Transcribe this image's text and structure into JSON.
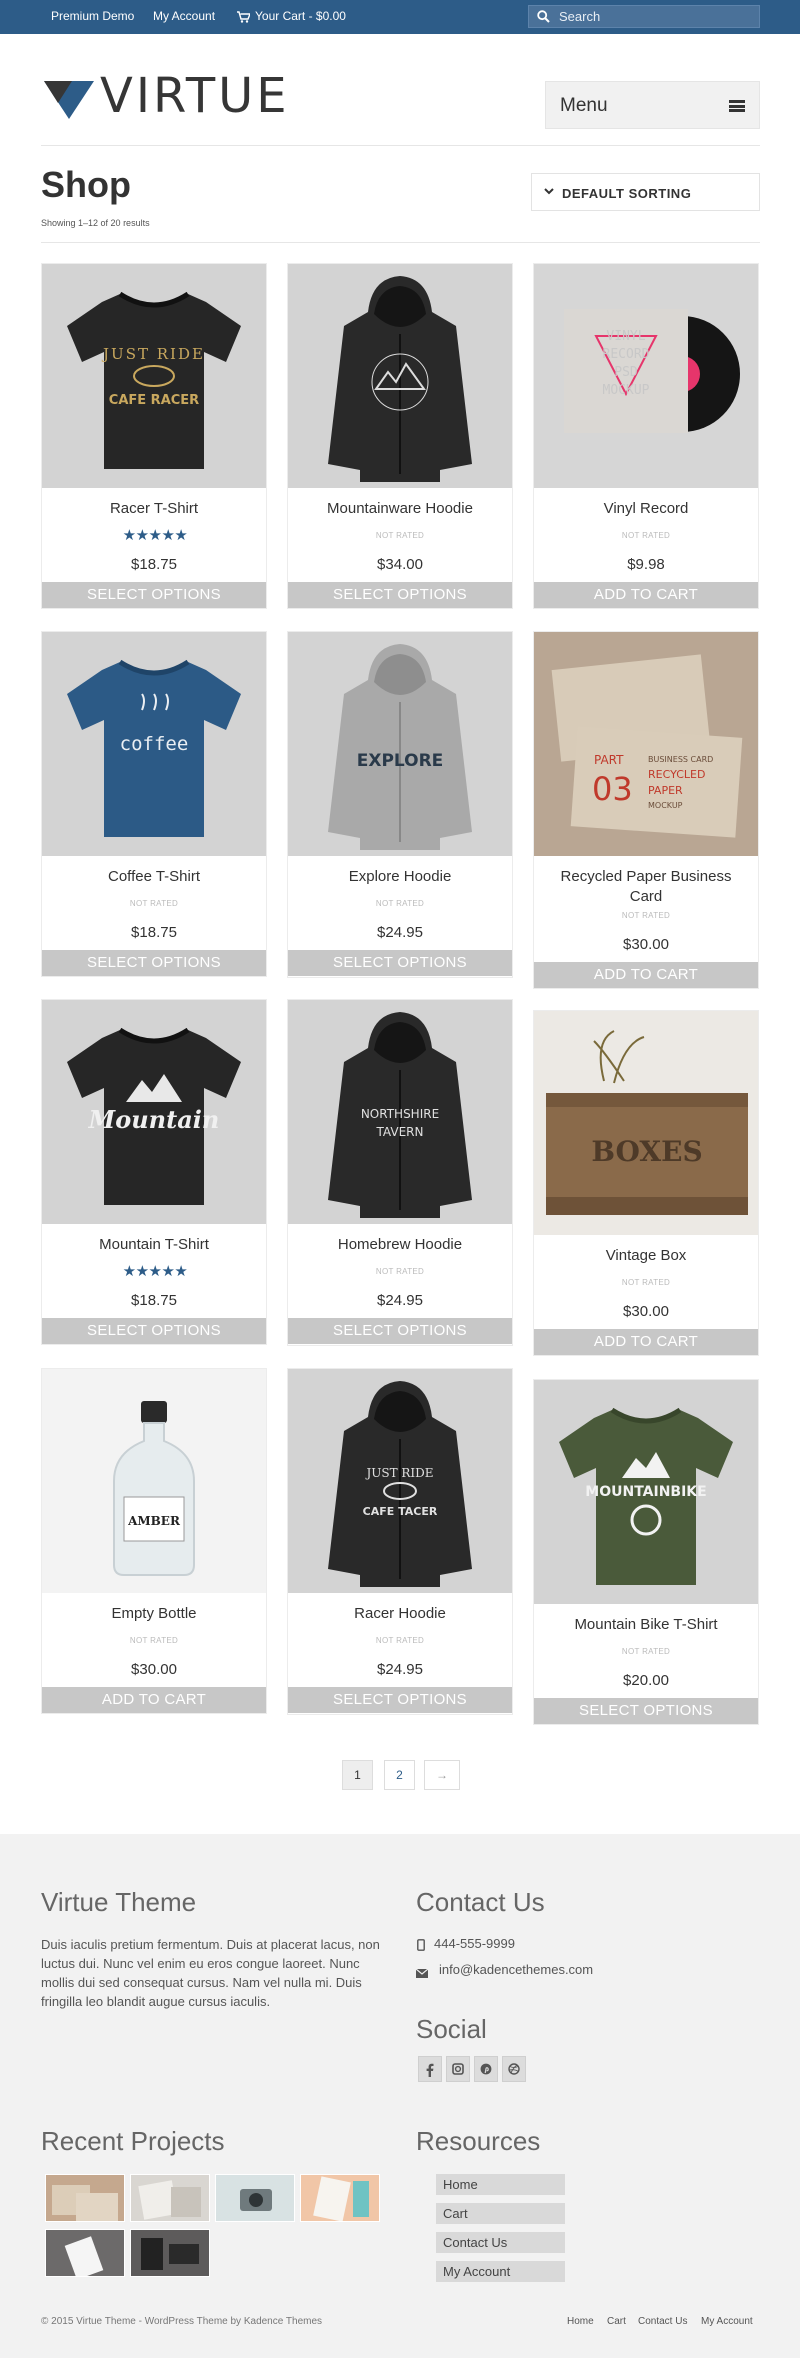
{
  "topbar": {
    "links": [
      "Premium Demo",
      "My Account",
      "Your Cart - $0.00"
    ],
    "search_placeholder": "Search"
  },
  "header": {
    "logo_text": "VIRTUE",
    "menu_label": "Menu"
  },
  "shop": {
    "title": "Shop",
    "result_count": "Showing 1–12 of 20 results",
    "sorting_label": "DEFAULT SORTING"
  },
  "products": [
    {
      "title": "Racer T-Shirt",
      "rating": "5 stars",
      "price": "$18.75",
      "button": "SELECT OPTIONS",
      "image": "black-tshirt-just-ride",
      "bg": "#d3d3d3"
    },
    {
      "title": "Mountainware Hoodie",
      "rating": "NOT RATED",
      "price": "$34.00",
      "button": "SELECT OPTIONS",
      "image": "black-hoodie-mountain",
      "bg": "#d3d3d3"
    },
    {
      "title": "Vinyl Record",
      "rating": "NOT RATED",
      "price": "$9.98",
      "button": "ADD TO CART",
      "image": "vinyl-record-mockup",
      "bg": "#d6d6d6"
    },
    {
      "title": "Coffee T-Shirt",
      "rating": "NOT RATED",
      "price": "$18.75",
      "button": "SELECT OPTIONS",
      "image": "blue-tshirt-coffee",
      "bg": "#d3d3d3"
    },
    {
      "title": "Explore Hoodie",
      "rating": "NOT RATED",
      "price": "$24.95",
      "button": "SELECT OPTIONS",
      "image": "grey-hoodie-explore",
      "bg": "#d3d3d3"
    },
    {
      "title": "Recycled Paper Business Card",
      "rating": "NOT RATED",
      "price": "$30.00",
      "button": "ADD TO CART",
      "image": "paper-business-cards",
      "bg": "#c8b9a8"
    },
    {
      "title": "Mountain T-Shirt",
      "rating": "5 stars",
      "price": "$18.75",
      "button": "SELECT OPTIONS",
      "image": "black-tshirt-mountain",
      "bg": "#d3d3d3"
    },
    {
      "title": "Homebrew Hoodie",
      "rating": "NOT RATED",
      "price": "$24.95",
      "button": "SELECT OPTIONS",
      "image": "black-hoodie-tavern",
      "bg": "#d3d3d3"
    },
    {
      "title": "Vintage Box",
      "rating": "NOT RATED",
      "price": "$30.00",
      "button": "ADD TO CART",
      "image": "wooden-boxes-crate",
      "bg": "#ece9e4"
    },
    {
      "title": "Empty Bottle",
      "rating": "NOT RATED",
      "price": "$30.00",
      "button": "ADD TO CART",
      "image": "glass-bottle-amber",
      "bg": "#f3f3f3"
    },
    {
      "title": "Racer Hoodie",
      "rating": "NOT RATED",
      "price": "$24.95",
      "button": "SELECT OPTIONS",
      "image": "black-hoodie-just-ride",
      "bg": "#d3d3d3"
    },
    {
      "title": "Mountain Bike T-Shirt",
      "rating": "NOT RATED",
      "price": "$20.00",
      "button": "SELECT OPTIONS",
      "image": "green-tshirt-mountainbike",
      "bg": "#d3d3d3"
    }
  ],
  "artwork": {
    "just_ride": "JUST RIDE",
    "cafe_racer": "CAFE RACER",
    "cafe_tacer": "CAFE TACER",
    "vinyl": [
      "VINYL",
      "RECORD",
      "PSD",
      "MOCKUP"
    ],
    "coffee": "coffee",
    "explore": "EXPLORE",
    "card_part": "PART",
    "card_num": "03",
    "card_lines": [
      "BUSINESS CARD",
      "RECYCLED",
      "PAPER",
      "MOCKUP"
    ],
    "mountain": "Mountain",
    "northshire": "NORTHSHIRE",
    "tavern": "TAVERN",
    "boxes": "BOXES",
    "amber": "AMBER",
    "mountainbike": "MOUNTAINBIKE"
  },
  "pagination": {
    "pages": [
      "1",
      "2"
    ],
    "next": "→"
  },
  "footer": {
    "about_heading": "Virtue Theme",
    "about_text": "Duis iaculis pretium fermentum. Duis at placerat lacus, non luctus dui. Nunc vel enim eu eros congue laoreet. Nunc mollis dui sed consequat cursus. Nam vel nulla mi. Duis fringilla leo blandit augue cursus iaculis.",
    "contact_heading": "Contact Us",
    "phone": "444-555-9999",
    "email": "info@kadencethemes.com",
    "social_heading": "Social",
    "projects_heading": "Recent Projects",
    "resources_heading": "Resources",
    "resources": [
      "Home",
      "Cart",
      "Contact Us",
      "My Account"
    ],
    "copyright": "© 2015 Virtue Theme - WordPress Theme by Kadence Themes",
    "bottom_links": [
      "Home",
      "Cart",
      "Contact Us",
      "My Account"
    ]
  },
  "colors": {
    "topbar": "#2d5c88",
    "accent": "#2d5c88",
    "button": "#c7c7c7",
    "footer_bg": "#f2f2f2"
  },
  "icons": [
    "search-icon",
    "cart-icon",
    "menu-icon",
    "chevron-down-icon",
    "phone-icon",
    "envelope-icon",
    "facebook-icon",
    "instagram-icon",
    "pinterest-icon",
    "dribbble-icon"
  ]
}
